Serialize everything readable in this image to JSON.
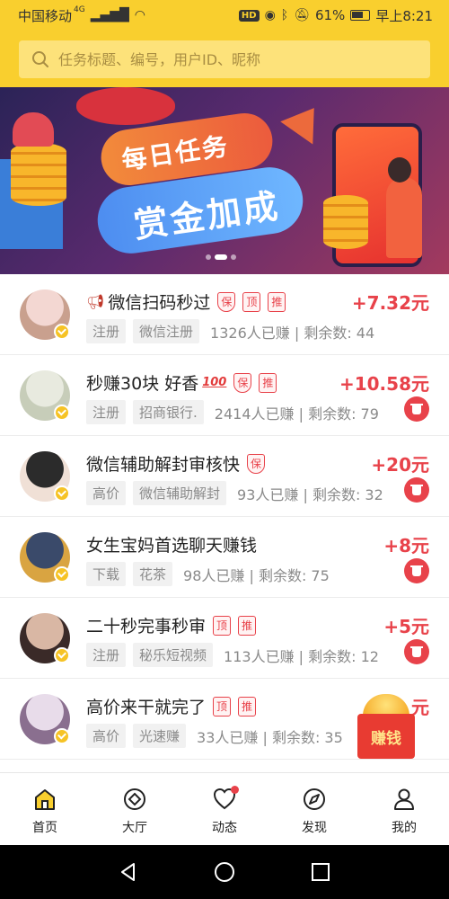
{
  "status_bar": {
    "carrier": "中国移动",
    "network": "4G",
    "hd_badge": "HD",
    "battery": "61%",
    "time": "早上8:21"
  },
  "search": {
    "placeholder": "任务标题、编号，用户ID、昵称"
  },
  "banner": {
    "line1": "每日任务",
    "line2": "赏金加成",
    "slide_count": 3,
    "active_slide": 2
  },
  "tasks": [
    {
      "title": "微信扫码秒过",
      "prefix_icon": "megaphone-icon",
      "badges": [
        "保",
        "顶",
        "推"
      ],
      "amount": "+7.32元",
      "tags": [
        "注册",
        "微信注册"
      ],
      "stats": "1326人已赚 | 剩余数: 44",
      "action_icon": false,
      "avatar_colors": [
        "#f3d7d2",
        "#c9a08e"
      ]
    },
    {
      "title": "秒赚30块 好香",
      "suffix_emoji": "100",
      "badges": [
        "保",
        "推"
      ],
      "amount": "+10.58元",
      "tags": [
        "注册",
        "招商银行."
      ],
      "stats": "2414人已赚 | 剩余数: 79",
      "action_icon": true,
      "avatar_colors": [
        "#e8eadf",
        "#c7cdb9"
      ]
    },
    {
      "title": "微信辅助解封审核快",
      "badges": [
        "保"
      ],
      "amount": "+20元",
      "tags": [
        "高价",
        "微信辅助解封"
      ],
      "stats": "93人已赚 | 剩余数: 32",
      "action_icon": true,
      "avatar_colors": [
        "#2b2b2b",
        "#f0e0d6"
      ]
    },
    {
      "title": "女生宝妈首选聊天赚钱",
      "badges": [],
      "amount": "+8元",
      "tags": [
        "下载",
        "花茶"
      ],
      "stats": "98人已赚 | 剩余数: 75",
      "action_icon": true,
      "avatar_colors": [
        "#3a4a6a",
        "#d9a441"
      ]
    },
    {
      "title": "二十秒完事秒审",
      "badges": [
        "顶",
        "推"
      ],
      "amount": "+5元",
      "tags": [
        "注册",
        "秘乐短视频"
      ],
      "stats": "113人已赚 | 剩余数: 12",
      "action_icon": true,
      "avatar_colors": [
        "#d9b7a4",
        "#3a2a28"
      ]
    },
    {
      "title": "高价来干就完了",
      "badges": [
        "顶",
        "推"
      ],
      "amount": "+1__元",
      "tags": [
        "高价",
        "光速赚"
      ],
      "stats": "33人已赚 | 剩余数: 35",
      "action_icon": false,
      "avatar_colors": [
        "#e8dcea",
        "#8a6f8f"
      ]
    }
  ],
  "floating_packet": {
    "label": "赚钱"
  },
  "tabs": [
    {
      "label": "首页",
      "icon": "home-icon",
      "active": true
    },
    {
      "label": "大厅",
      "icon": "hall-icon",
      "active": false
    },
    {
      "label": "动态",
      "icon": "heart-icon",
      "active": false,
      "notification": true
    },
    {
      "label": "发现",
      "icon": "compass-icon",
      "active": false
    },
    {
      "label": "我的",
      "icon": "user-icon",
      "active": false
    }
  ],
  "colors": {
    "brand_yellow": "#f9cf2e",
    "accent_red": "#e8424a",
    "tag_gray": "#8a8a8a"
  }
}
